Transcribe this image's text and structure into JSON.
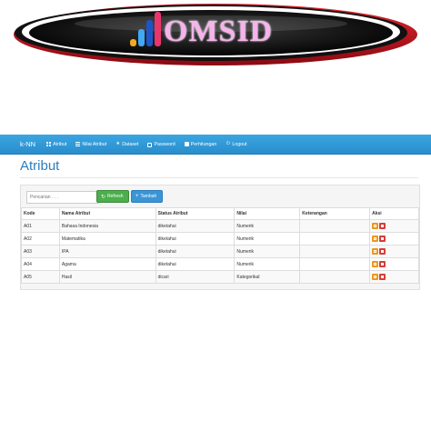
{
  "logo": {
    "text": "OMSID"
  },
  "navbar": {
    "brand": "k-NN",
    "items": [
      {
        "label": "Atribut",
        "icon": "grid-icon"
      },
      {
        "label": "Nilai Atribut",
        "icon": "list-icon"
      },
      {
        "label": "Dataset",
        "icon": "star-icon"
      },
      {
        "label": "Password",
        "icon": "lock-icon"
      },
      {
        "label": "Perhitungan",
        "icon": "calendar-icon"
      },
      {
        "label": "Logout",
        "icon": "logout-icon"
      }
    ]
  },
  "page": {
    "title": "Atribut"
  },
  "toolbar": {
    "search_placeholder": "Pencarian . . .",
    "refresh_label": "Refresh",
    "add_label": "Tambah"
  },
  "table": {
    "headers": [
      "Kode",
      "Nama Atribut",
      "Status Atribut",
      "Nilai",
      "Keterangan",
      "Aksi"
    ],
    "rows": [
      {
        "kode": "A01",
        "nama": "Bahasa Indonesia",
        "status": "diketahui",
        "nilai": "Numerik",
        "keterangan": ""
      },
      {
        "kode": "A02",
        "nama": "Matematika",
        "status": "diketahui",
        "nilai": "Numerik",
        "keterangan": ""
      },
      {
        "kode": "A03",
        "nama": "IPA",
        "status": "diketahui",
        "nilai": "Numerik",
        "keterangan": ""
      },
      {
        "kode": "A04",
        "nama": "Agama",
        "status": "diketahui",
        "nilai": "Numerik",
        "keterangan": ""
      },
      {
        "kode": "A05",
        "nama": "Hasil",
        "status": "dicari",
        "nilai": "Kategorikal",
        "keterangan": ""
      }
    ]
  },
  "colors": {
    "navbar": "#2a8dcc",
    "title": "#2b7ec1",
    "refresh": "#4cae4c",
    "add": "#3a95d6",
    "edit": "#ec971f",
    "delete": "#d43f3a",
    "logo_ring": "#c0101a",
    "logo_text": "#f6b3ec"
  }
}
